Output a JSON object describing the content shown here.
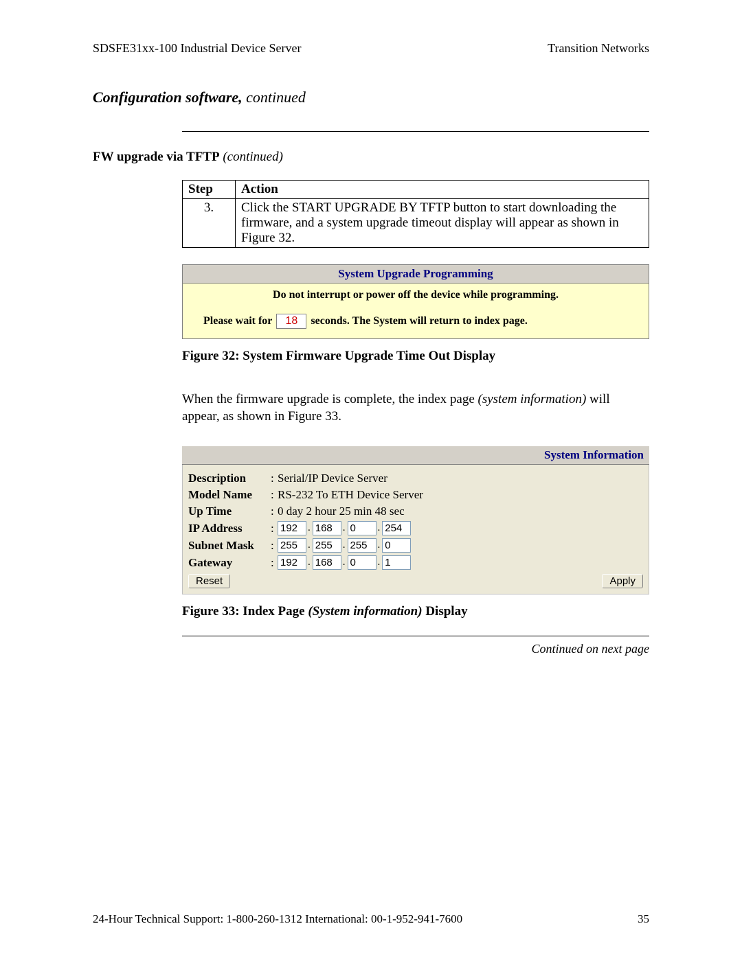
{
  "header": {
    "left": "SDSFE31xx-100 Industrial Device Server",
    "right": "Transition Networks"
  },
  "section_title": {
    "bold": "Configuration software,",
    "rest": " continued"
  },
  "sub_heading": {
    "bold": "FW upgrade via TFTP",
    "rest": " (continued)"
  },
  "step_table": {
    "headers": {
      "step": "Step",
      "action": "Action"
    },
    "rows": [
      {
        "num": "3.",
        "action": "Click the START UPGRADE BY TFTP button to start downloading the firmware, and a system upgrade timeout display will appear as shown in Figure 32."
      }
    ]
  },
  "fig32": {
    "title": "System Upgrade Programming",
    "warn": "Do not interrupt or power off the device while programming.",
    "wait_pre": "Please wait for",
    "count": "18",
    "wait_post": "seconds. The System will return to index page.",
    "caption": "Figure 32:  System Firmware Upgrade Time Out Display"
  },
  "bodytext": {
    "pre": "When the firmware upgrade is complete, the index page ",
    "italic": "(system information)",
    "post": " will appear, as shown in Figure 33."
  },
  "fig33": {
    "title": "System Information",
    "rows": {
      "description": {
        "label": "Description",
        "value": "Serial/IP Device Server"
      },
      "model": {
        "label": "Model Name",
        "value": "RS-232 To ETH Device Server"
      },
      "uptime": {
        "label": "Up Time",
        "value": "0 day 2 hour 25 min 48 sec"
      },
      "ip": {
        "label": "IP Address",
        "o1": "192",
        "o2": "168",
        "o3": "0",
        "o4": "254"
      },
      "mask": {
        "label": "Subnet Mask",
        "o1": "255",
        "o2": "255",
        "o3": "255",
        "o4": "0"
      },
      "gw": {
        "label": "Gateway",
        "o1": "192",
        "o2": "168",
        "o3": "0",
        "o4": "1"
      }
    },
    "buttons": {
      "reset": "Reset",
      "apply": "Apply"
    },
    "caption_pre": "Figure 33:  Index Page ",
    "caption_italic": "(System information)",
    "caption_post": " Display"
  },
  "continued": "Continued on next page",
  "footer": {
    "left": "24-Hour Technical Support:  1-800-260-1312   International: 00-1-952-941-7600",
    "page": "35"
  }
}
